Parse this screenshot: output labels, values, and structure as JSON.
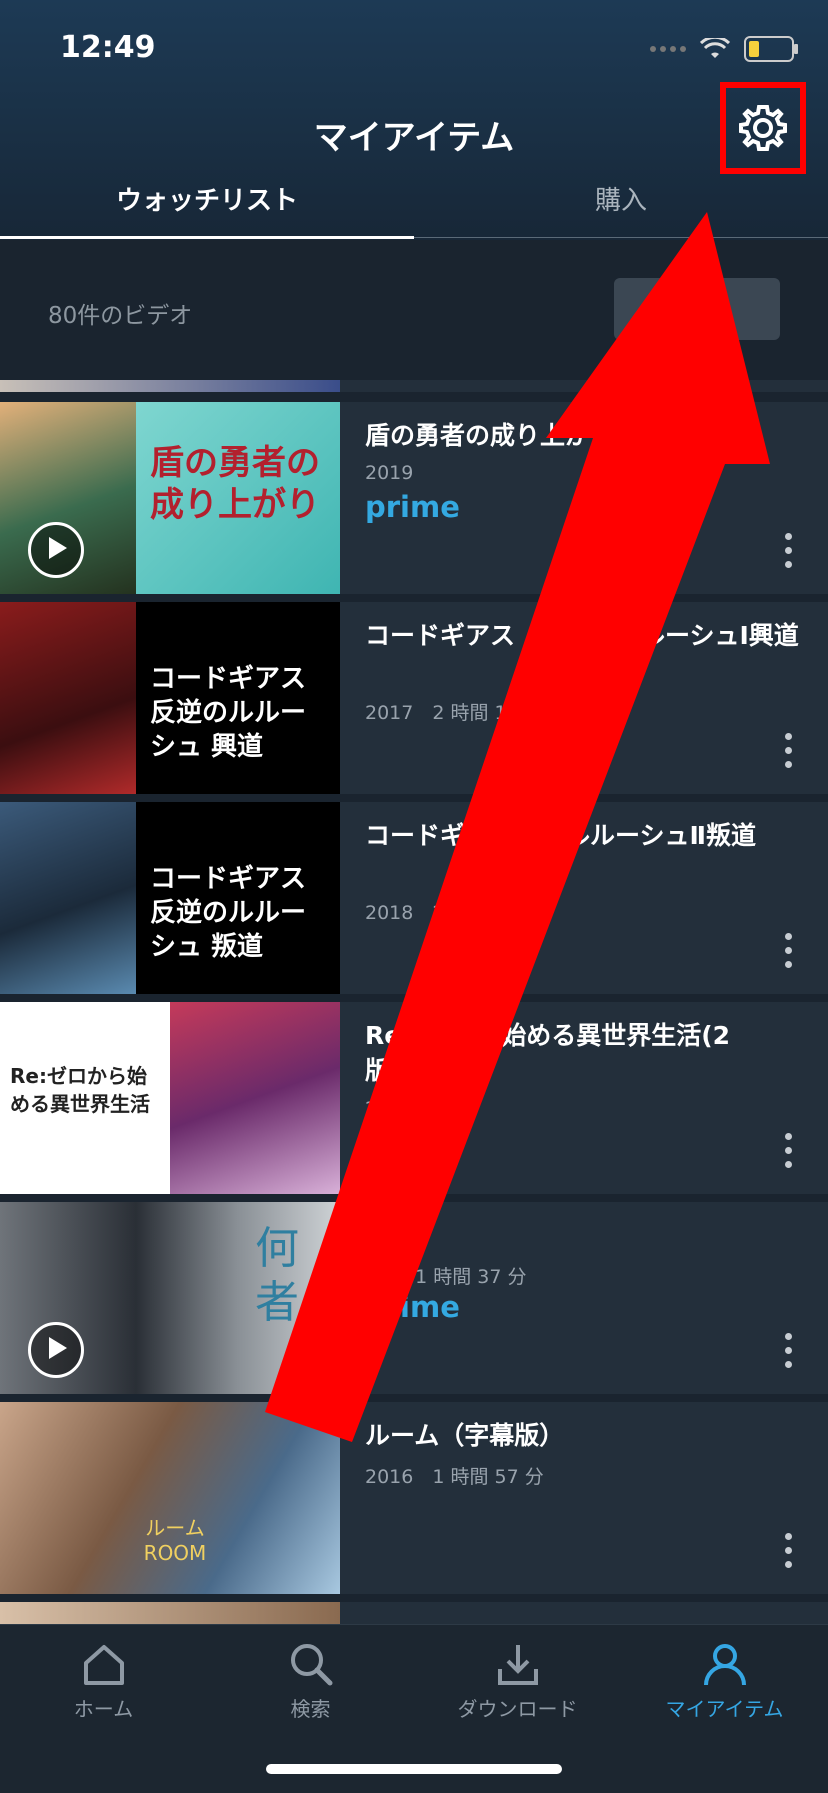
{
  "status_bar": {
    "time": "12:49"
  },
  "header": {
    "title": "マイアイテム"
  },
  "tabs": [
    {
      "label": "ウォッチリスト",
      "active": true
    },
    {
      "label": "購入",
      "active": false
    }
  ],
  "watchlist": {
    "count_label": "80件のビデオ"
  },
  "items": [
    {
      "title": "盾の勇者の成り上が",
      "meta": "2019",
      "badge": "prime",
      "thumb_caption": "盾の勇者の成り上がり"
    },
    {
      "title": "コードギアス　　　ルルルーシュⅠ興道",
      "meta": "2017　2 時間 15",
      "thumb_caption": "コードギアス 反逆のルルーシュ 興道"
    },
    {
      "title": "コードギ　反逆のルルーシュⅡ叛道",
      "meta": "2018　2　　　分",
      "thumb_caption": "コードギアス 反逆のルルーシュ 叛道"
    },
    {
      "title": "Re　　から始める異世界生活(2　　版)",
      "meta": "2",
      "thumb_caption": "Re:ゼロから始める異世界生活"
    },
    {
      "title": "　者",
      "meta": "　6　1 時間 37 分",
      "badge": "prime",
      "thumb_caption": "何者"
    },
    {
      "title": "ルーム（字幕版）",
      "meta": "2016　1 時間 57 分",
      "thumb_caption": "ルーム ROOM"
    }
  ],
  "bottom_nav": [
    {
      "label": "ホーム",
      "icon": "home-icon",
      "active": false
    },
    {
      "label": "検索",
      "icon": "search-icon",
      "active": false
    },
    {
      "label": "ダウンロード",
      "icon": "download-icon",
      "active": false
    },
    {
      "label": "マイアイテム",
      "icon": "person-icon",
      "active": true
    }
  ],
  "colors": {
    "accent": "#35a6e3",
    "prime": "#34a9e1",
    "annotation": "#ff0000"
  }
}
